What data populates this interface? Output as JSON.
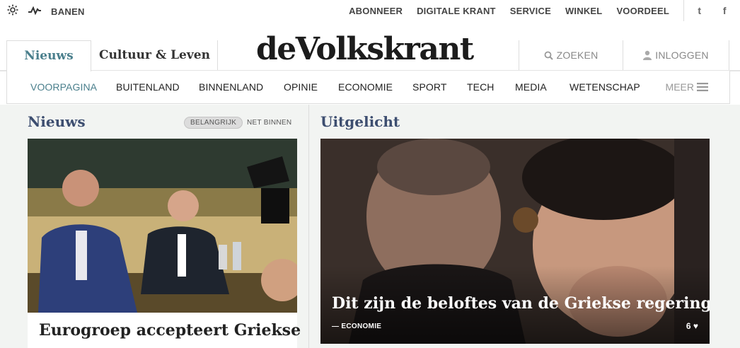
{
  "utility": {
    "banen": "BANEN",
    "links": [
      "ABONNEER",
      "DIGITALE KRANT",
      "SERVICE",
      "WINKEL",
      "VOORDEEL"
    ],
    "twitter": "t",
    "facebook": "f"
  },
  "masthead": {
    "tab_nieuws": "Nieuws",
    "tab_cultuur": "Cultuur & Leven",
    "logo": "deVolkskrant",
    "search": "ZOEKEN",
    "login": "INLOGGEN"
  },
  "subnav": {
    "items": [
      "VOORPAGINA",
      "BUITENLAND",
      "BINNENLAND",
      "OPINIE",
      "ECONOMIE",
      "SPORT",
      "TECH",
      "MEDIA",
      "WETENSCHAP"
    ],
    "more": "MEER"
  },
  "news": {
    "heading": "Nieuws",
    "filter_active": "BELANGRIJK",
    "filter_other": "NET BINNEN",
    "headline": "Eurogroep accepteert Griekse"
  },
  "featured": {
    "heading": "Uitgelicht",
    "title": "Dit zijn de beloftes van de Griekse regering",
    "category": "ECONOMIE",
    "likes": "6"
  },
  "colors": {
    "accent": "#4a7f8c",
    "heading": "#3d4e70",
    "background": "#f2f4f2"
  }
}
